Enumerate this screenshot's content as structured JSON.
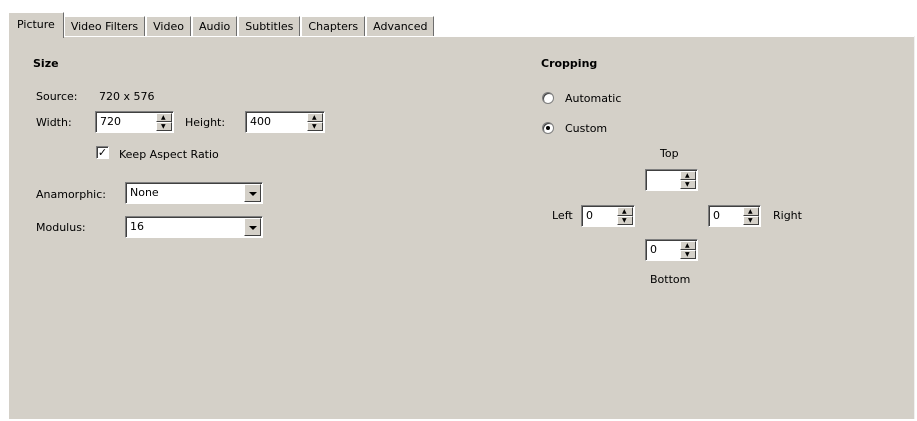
{
  "tabs": [
    {
      "label": "Picture",
      "active": true
    },
    {
      "label": "Video Filters",
      "active": false
    },
    {
      "label": "Video",
      "active": false
    },
    {
      "label": "Audio",
      "active": false
    },
    {
      "label": "Subtitles",
      "active": false
    },
    {
      "label": "Chapters",
      "active": false
    },
    {
      "label": "Advanced",
      "active": false
    }
  ],
  "size": {
    "title": "Size",
    "source_label": "Source:",
    "source_value": "720 x 576",
    "width_label": "Width:",
    "width_value": "720",
    "height_label": "Height:",
    "height_value": "400",
    "keep_aspect_label": "Keep Aspect Ratio",
    "keep_aspect_checked": true,
    "anamorphic_label": "Anamorphic:",
    "anamorphic_value": "None",
    "modulus_label": "Modulus:",
    "modulus_value": "16"
  },
  "cropping": {
    "title": "Cropping",
    "automatic_label": "Automatic",
    "custom_label": "Custom",
    "selected": "custom",
    "top_label": "Top",
    "top_value": "",
    "left_label": "Left",
    "left_value": "0",
    "right_label": "Right",
    "right_value": "0",
    "bottom_label": "Bottom",
    "bottom_value": "0"
  },
  "colors": {
    "panel_bg": "#d4d0c8",
    "field_bg": "#ffffff"
  }
}
